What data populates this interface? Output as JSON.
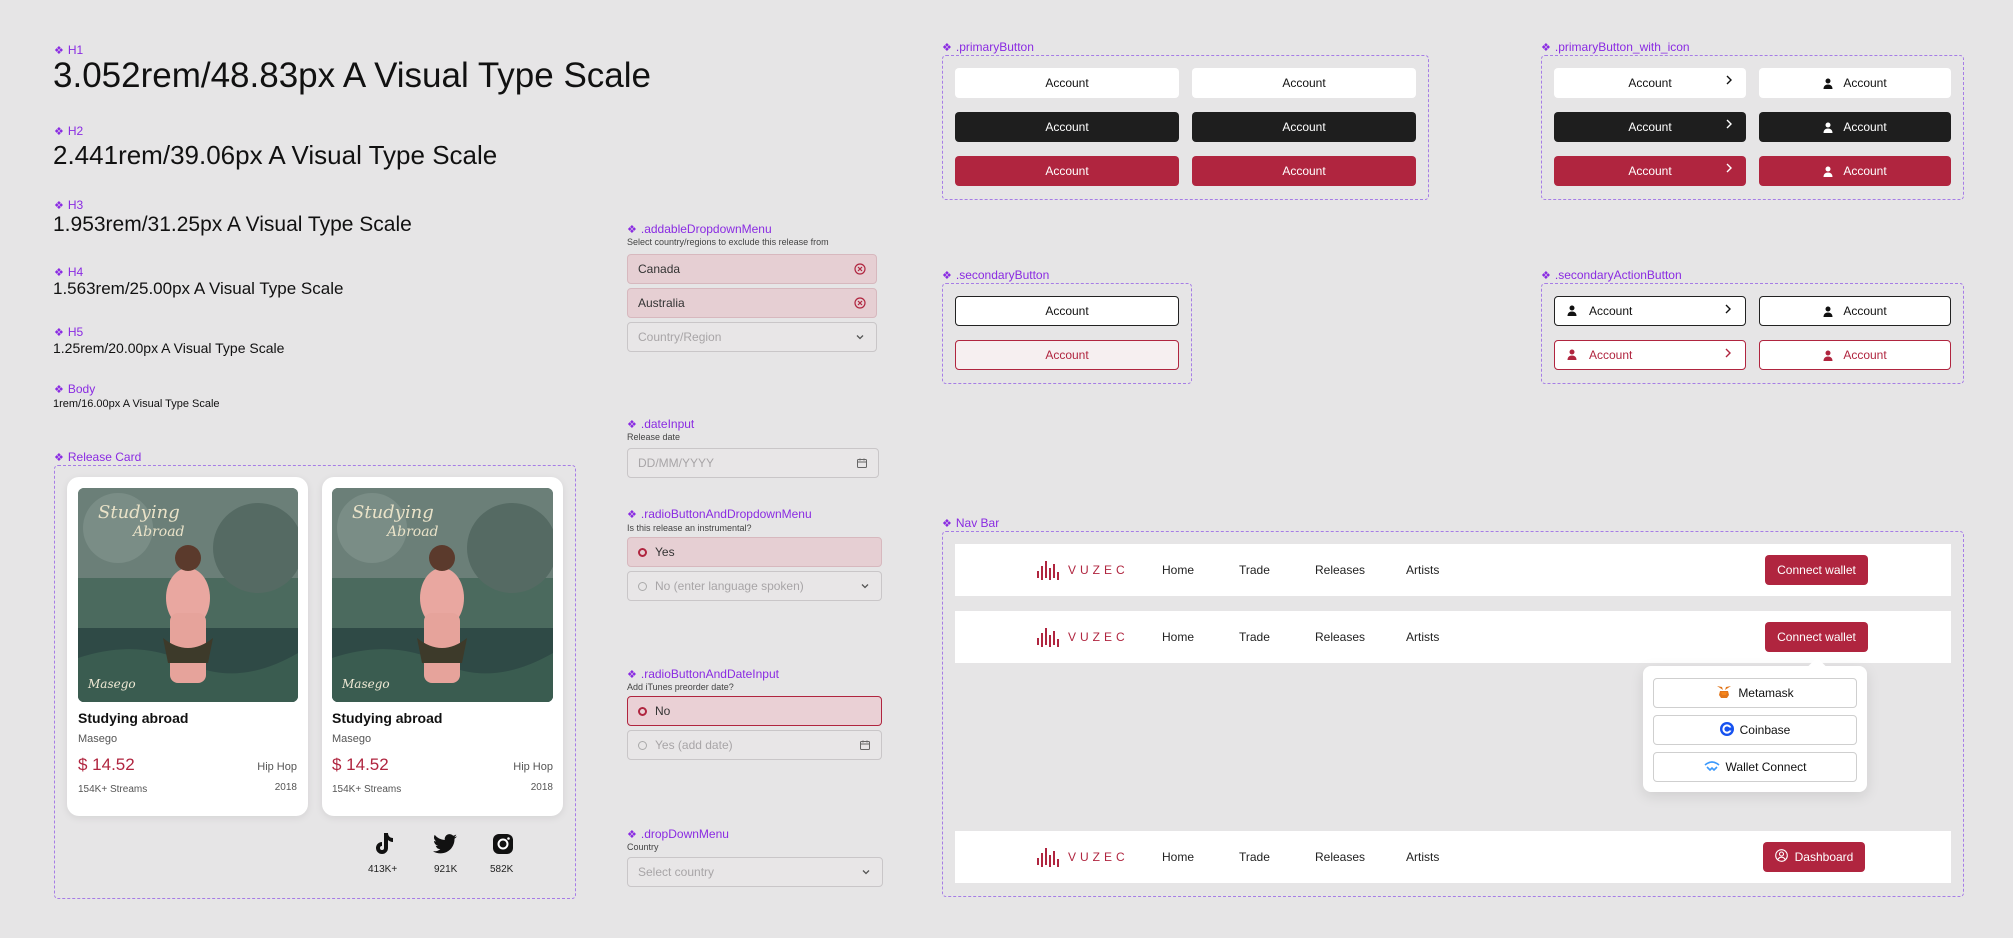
{
  "type_scale": {
    "h1": {
      "tag": "H1",
      "sample": "3.052rem/48.83px A Visual Type Scale"
    },
    "h2": {
      "tag": "H2",
      "sample": "2.441rem/39.06px A Visual Type Scale"
    },
    "h3": {
      "tag": "H3",
      "sample": "1.953rem/31.25px A Visual Type Scale"
    },
    "h4": {
      "tag": "H4",
      "sample": "1.563rem/25.00px A Visual Type Scale"
    },
    "h5": {
      "tag": "H5",
      "sample": "1.25rem/20.00px A Visual Type Scale"
    },
    "body": {
      "tag": "Body",
      "sample": "1rem/16.00px A Visual Type Scale"
    }
  },
  "release_card": {
    "section_label": "Release Card",
    "cards": [
      {
        "title": "Studying abroad",
        "artist": "Masego",
        "price": "$ 14.52",
        "genre": "Hip Hop",
        "streams": "154K+ Streams",
        "year": "2018"
      },
      {
        "title": "Studying abroad",
        "artist": "Masego",
        "price": "$ 14.52",
        "genre": "Hip Hop",
        "streams": "154K+ Streams",
        "year": "2018"
      }
    ],
    "social": [
      {
        "icon": "tiktok-icon",
        "count": "413K+"
      },
      {
        "icon": "twitter-icon",
        "count": "921K"
      },
      {
        "icon": "instagram-icon",
        "count": "582K"
      }
    ]
  },
  "addable_dropdown": {
    "label": ".addableDropdownMenu",
    "hint": "Select country/regions to exclude this release from",
    "items": [
      "Canada",
      "Australia"
    ],
    "placeholder": "Country/Region"
  },
  "date_input": {
    "label": ".dateInput",
    "hint": "Release date",
    "placeholder": "DD/MM/YYYY"
  },
  "radio_dropdown": {
    "label": ".radioButtonAndDropdownMenu",
    "hint": "Is this release an instrumental?",
    "selected": "Yes",
    "other": "No (enter language spoken)"
  },
  "radio_date": {
    "label": ".radioButtonAndDateInput",
    "hint": "Add iTunes preorder date?",
    "selected": "No",
    "other": "Yes (add date)"
  },
  "dropdown": {
    "label": ".dropDownMenu",
    "hint": "Country",
    "placeholder": "Select country"
  },
  "primary_button": {
    "label": ".primaryButton",
    "text": "Account"
  },
  "primary_button_icon": {
    "label": ".primaryButton_with_icon",
    "text": "Account"
  },
  "secondary_button": {
    "label": ".secondaryButton",
    "text": "Account"
  },
  "secondary_action": {
    "label": ".secondaryActionButton",
    "text": "Account"
  },
  "nav_bar": {
    "label": "Nav Bar",
    "logo": "VUZEC",
    "links": [
      "Home",
      "Trade",
      "Releases",
      "Artists"
    ],
    "connect": "Connect wallet",
    "dashboard": "Dashboard",
    "wallets": [
      {
        "icon": "metamask-icon",
        "name": "Metamask"
      },
      {
        "icon": "coinbase-icon",
        "name": "Coinbase"
      },
      {
        "icon": "walletconnect-icon",
        "name": "Wallet Connect"
      }
    ]
  },
  "colors": {
    "accent": "#b0253f",
    "annotation": "#8a2be2",
    "dark": "#1e1e1e"
  }
}
